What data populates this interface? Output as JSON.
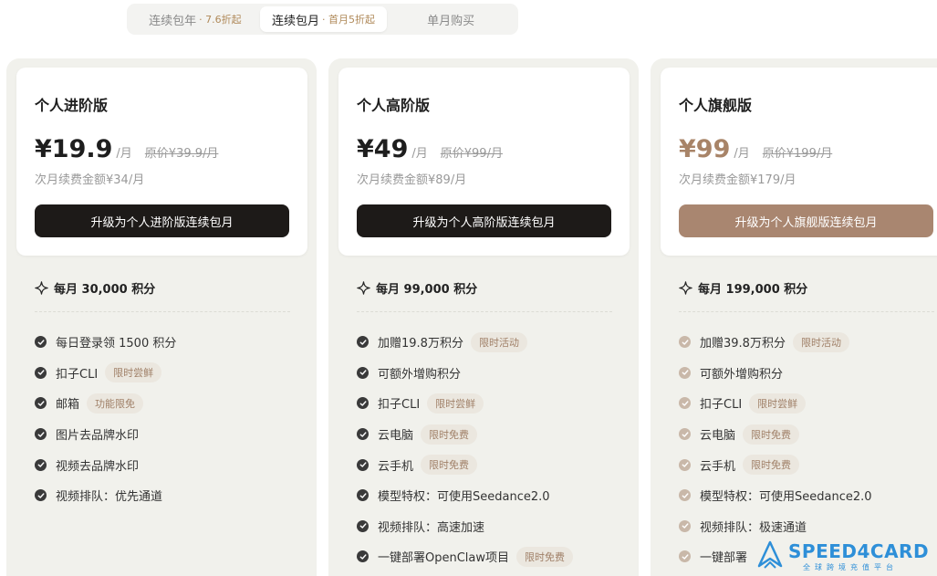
{
  "tabs": [
    {
      "label": "连续包年",
      "sub": "· 7.6折起",
      "active": false
    },
    {
      "label": "连续包月",
      "sub": "· 首月5折起",
      "active": true
    },
    {
      "label": "单月购买",
      "sub": "",
      "active": false
    }
  ],
  "plans": [
    {
      "name": "个人进阶版",
      "price": "¥19.9",
      "per": "/月",
      "original": "原价¥39.9/月",
      "renew": "次月续费金额¥34/月",
      "cta": "升级为个人进阶版连续包月",
      "credits": "每月 30,000 积分",
      "features": [
        {
          "text": "每日登录领 1500 积分",
          "badge": ""
        },
        {
          "text": "扣子CLI",
          "badge": "限时尝鲜"
        },
        {
          "text": "邮箱",
          "badge": "功能限免"
        },
        {
          "text": "图片去品牌水印",
          "badge": ""
        },
        {
          "text": "视频去品牌水印",
          "badge": ""
        },
        {
          "text": "视频排队：优先通道",
          "badge": ""
        }
      ]
    },
    {
      "name": "个人高阶版",
      "price": "¥49",
      "per": "/月",
      "original": "原价¥99/月",
      "renew": "次月续费金额¥89/月",
      "cta": "升级为个人高阶版连续包月",
      "credits": "每月 99,000 积分",
      "features": [
        {
          "text": "加赠19.8万积分",
          "badge": "限时活动"
        },
        {
          "text": "可额外增购积分",
          "badge": ""
        },
        {
          "text": "扣子CLI",
          "badge": "限时尝鲜"
        },
        {
          "text": "云电脑",
          "badge": "限时免费"
        },
        {
          "text": "云手机",
          "badge": "限时免费"
        },
        {
          "text": "模型特权：可使用Seedance2.0",
          "badge": ""
        },
        {
          "text": "视频排队：高速加速",
          "badge": ""
        },
        {
          "text": "一键部署OpenClaw项目",
          "badge": "限时免费"
        }
      ]
    },
    {
      "name": "个人旗舰版",
      "price": "¥99",
      "per": "/月",
      "original": "原价¥199/月",
      "renew": "次月续费金额¥179/月",
      "cta": "升级为个人旗舰版连续包月",
      "credits": "每月 199,000 积分",
      "features": [
        {
          "text": "加赠39.8万积分",
          "badge": "限时活动"
        },
        {
          "text": "可额外增购积分",
          "badge": ""
        },
        {
          "text": "扣子CLI",
          "badge": "限时尝鲜"
        },
        {
          "text": "云电脑",
          "badge": "限时免费"
        },
        {
          "text": "云手机",
          "badge": "限时免费"
        },
        {
          "text": "模型特权：可使用Seedance2.0",
          "badge": ""
        },
        {
          "text": "视频排队：极速通道",
          "badge": ""
        },
        {
          "text": "一键部署",
          "badge": ""
        }
      ]
    }
  ],
  "watermark": {
    "brand": "SPEED4CARD",
    "sub": "全球跨境充值平台"
  },
  "colors": {
    "accent": "#a98670",
    "dark": "#1d1a18",
    "badge_bg": "#ebe7df",
    "badge_text": "#a08068",
    "watermark": "#2e8fd8"
  },
  "icons": {
    "credits": "sparkle-icon",
    "feature": "check-circle-icon"
  }
}
